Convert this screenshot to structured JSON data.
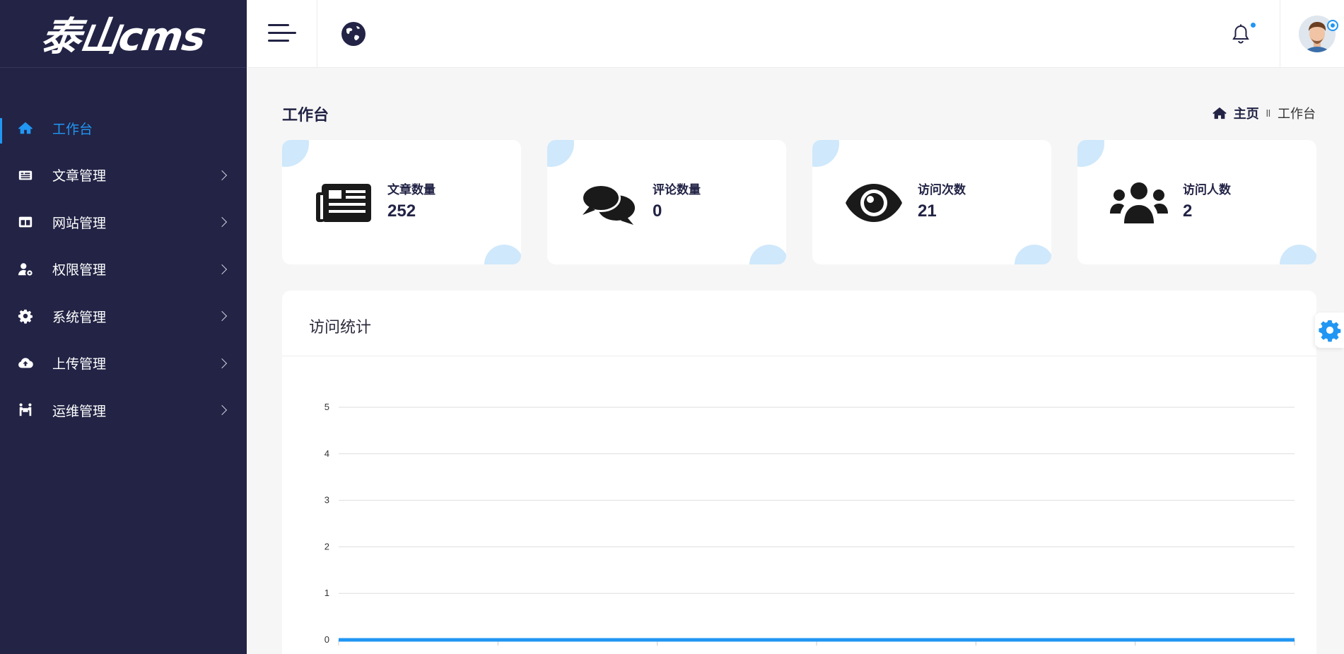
{
  "brand": {
    "logo_text": "泰山cms"
  },
  "sidebar": {
    "items": [
      {
        "label": "工作台",
        "icon": "home-icon",
        "active": true,
        "has_submenu": false
      },
      {
        "label": "文章管理",
        "icon": "article-icon",
        "active": false,
        "has_submenu": true
      },
      {
        "label": "网站管理",
        "icon": "columns-icon",
        "active": false,
        "has_submenu": true
      },
      {
        "label": "权限管理",
        "icon": "user-gear-icon",
        "active": false,
        "has_submenu": true
      },
      {
        "label": "系统管理",
        "icon": "gear-icon",
        "active": false,
        "has_submenu": true
      },
      {
        "label": "上传管理",
        "icon": "cloud-upload-icon",
        "active": false,
        "has_submenu": true
      },
      {
        "label": "运维管理",
        "icon": "people-carry-icon",
        "active": false,
        "has_submenu": true
      }
    ]
  },
  "header": {
    "menu_icon": "hamburger-icon",
    "site_icon": "globe-icon",
    "notification_icon": "bell-icon",
    "notification_dot": true
  },
  "page": {
    "title": "工作台",
    "breadcrumb": {
      "home": "主页",
      "separator": "ll",
      "current": "工作台"
    }
  },
  "stats": [
    {
      "label": "文章数量",
      "value": "252",
      "icon": "newspaper-icon"
    },
    {
      "label": "评论数量",
      "value": "0",
      "icon": "comments-icon"
    },
    {
      "label": "访问次数",
      "value": "21",
      "icon": "eye-icon"
    },
    {
      "label": "访问人数",
      "value": "2",
      "icon": "users-icon"
    }
  ],
  "colors": {
    "sidebar_bg": "#222345",
    "accent": "#2196f3",
    "card_corner": "#cfe8fb",
    "page_bg": "#f6f6f6"
  },
  "chart_title": "访问统计",
  "chart_data": {
    "type": "line",
    "title": "访问统计",
    "ylim": [
      0,
      5
    ],
    "yticks": [
      0,
      1,
      2,
      3,
      4,
      5
    ],
    "grid": true,
    "series": [
      {
        "values": [
          0,
          0,
          0,
          0,
          0,
          0,
          0
        ],
        "color": "#2196f3"
      }
    ]
  }
}
